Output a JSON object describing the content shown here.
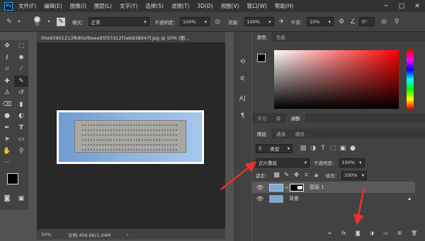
{
  "app": {
    "logo": "Ps"
  },
  "menu": [
    "文件(F)",
    "编辑(E)",
    "图像(I)",
    "图层(L)",
    "文字(Y)",
    "选择(S)",
    "滤镜(T)",
    "3D(D)",
    "视图(V)",
    "窗口(W)",
    "帮助(H)"
  ],
  "options": {
    "brush_size": "72",
    "mode_label": "模式：",
    "mode_value": "正常",
    "opacity_label": "不透明度：",
    "opacity_value": "100%",
    "flow_label": "流量：",
    "flow_value": "100%",
    "smooth_label": "平滑：",
    "smooth_value": "10%",
    "angle_value": "0°"
  },
  "document": {
    "tab_title": "00e93901213fb80efbeea95f37d12f2eb938947f.jpg @ 50% (图...",
    "zoom": "50%",
    "doc_info": "文档:456.6K/1.04M"
  },
  "panels": {
    "color_tabs": [
      "颜色",
      "色板"
    ],
    "adjust_tabs": [
      "学习",
      "库",
      "调整"
    ],
    "layer_tabs": [
      "图层",
      "通道",
      "路径"
    ],
    "filter_kind": "类型",
    "blend_mode": "正片叠底",
    "opacity_label": "不透明度：",
    "opacity_value": "100%",
    "lock_label": "锁定：",
    "fill_label": "填充：",
    "fill_value": "100%",
    "layers": [
      {
        "name": "图层 1"
      },
      {
        "name": "背景"
      }
    ],
    "bottom_icons": [
      "link-icon",
      "fx-icon",
      "mask-icon",
      "adjustment-icon",
      "folder-icon",
      "new-layer-icon",
      "trash-icon"
    ]
  },
  "annotation_color": "#e8322e"
}
